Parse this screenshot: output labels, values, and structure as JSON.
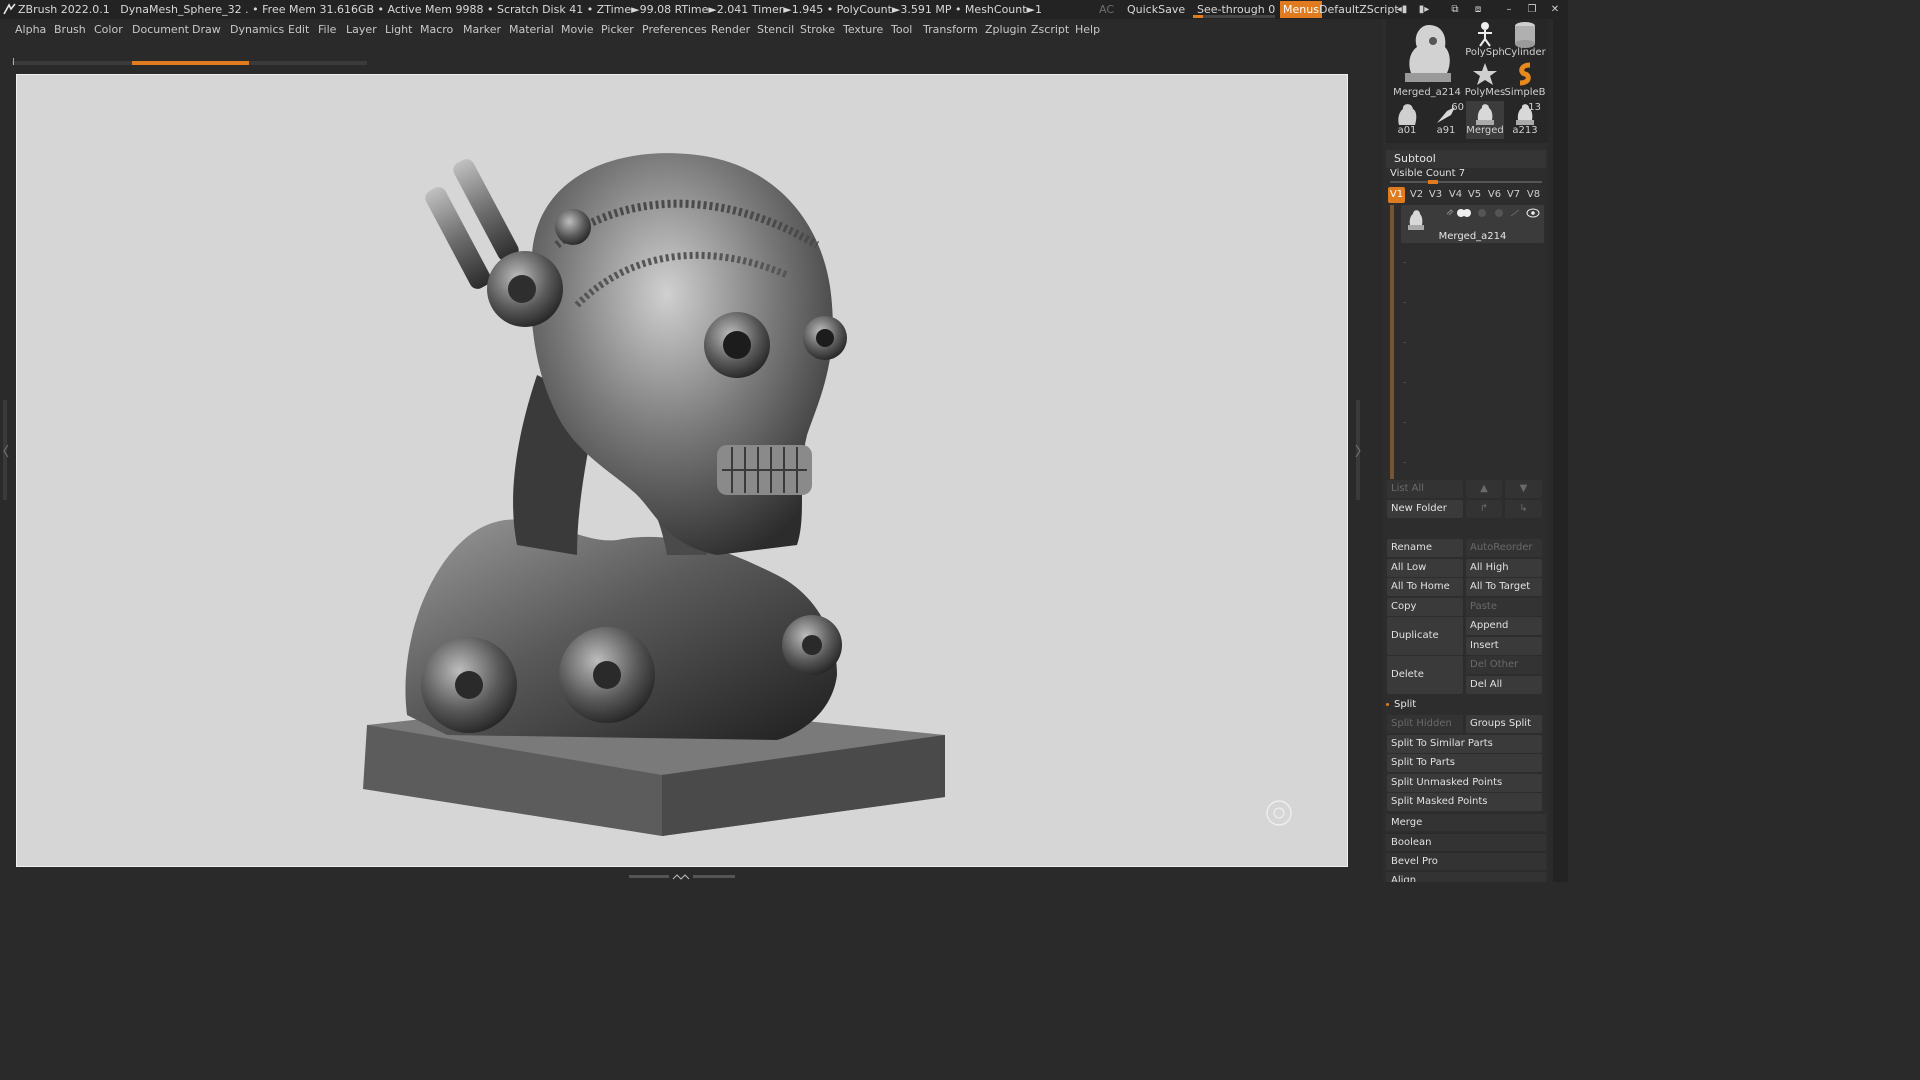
{
  "titlebar": {
    "app": "ZBrush 2022.0.1",
    "stats": "DynaMesh_Sphere_32  . • Free Mem 31.616GB • Active Mem 9988 • Scratch Disk 41 • ZTime►99.08 RTime►2.041 Timer►1.945 • PolyCount►3.591 MP  • MeshCount►1",
    "ac": "AC",
    "quicksave": "QuickSave",
    "seethrough": "See-through  0",
    "seethrough_value": 0,
    "menus": "Menus",
    "script": "DefaultZScript"
  },
  "menubar": [
    "Alpha",
    "Brush",
    "Color",
    "Document",
    "Draw",
    "Dynamics",
    "Edit",
    "File",
    "Layer",
    "Light",
    "Macro",
    "Marker",
    "Material",
    "Movie",
    "Picker",
    "Preferences",
    "Render",
    "Stencil",
    "Stroke",
    "Texture",
    "Tool",
    "Transform",
    "Zplugin",
    "Zscript",
    "Help"
  ],
  "tools": {
    "main": "Merged_a214",
    "items": [
      {
        "label": "PolySph",
        "icon": "polysphere-icon"
      },
      {
        "label": "Cylinder",
        "icon": "cylinder-icon"
      },
      {
        "label": "PolyMes",
        "icon": "polymesh-star-icon"
      },
      {
        "label": "SimpleB",
        "icon": "simplebrush-icon"
      },
      {
        "label": "a01",
        "icon": "skull-thumb-icon"
      },
      {
        "label": "a91",
        "icon": "tool-thumb-icon",
        "count": "60"
      },
      {
        "label": "Merged",
        "icon": "figure-thumb-icon"
      },
      {
        "label": "a213",
        "icon": "figure-thumb-icon",
        "count": "13"
      }
    ]
  },
  "subtool": {
    "title": "Subtool",
    "visible_count": "Visible Count 7",
    "vtabs": [
      "V1",
      "V2",
      "V3",
      "V4",
      "V5",
      "V6",
      "V7",
      "V8"
    ],
    "active_vtab": "V1",
    "item_name": "Merged_a214",
    "list_all": "List All",
    "new_folder": "New Folder",
    "rename": "Rename",
    "autoreorder": "AutoReorder",
    "all_low": "All Low",
    "all_high": "All High",
    "all_to_home": "All To Home",
    "all_to_target": "All To Target",
    "copy": "Copy",
    "paste": "Paste",
    "duplicate": "Duplicate",
    "append": "Append",
    "insert": "Insert",
    "delete": "Delete",
    "del_other": "Del Other",
    "del_all": "Del All",
    "split": "Split",
    "split_hidden": "Split Hidden",
    "groups_split": "Groups Split",
    "split_similar": "Split To Similar Parts",
    "split_parts": "Split To Parts",
    "split_unmasked": "Split Unmasked Points",
    "split_masked": "Split Masked Points",
    "merge": "Merge",
    "boolean": "Boolean",
    "bevel_pro": "Bevel Pro",
    "align": "Align"
  },
  "colors": {
    "accent": "#e07b1f",
    "canvas": "#d6d6d6",
    "panel": "#2d2d2d"
  }
}
